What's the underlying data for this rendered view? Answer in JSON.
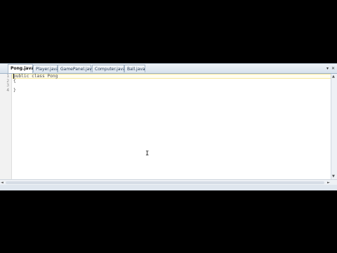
{
  "tabs": [
    {
      "label": "Pong.java",
      "active": true
    },
    {
      "label": "Player.java",
      "active": false
    },
    {
      "label": "GamePanel.java",
      "active": false
    },
    {
      "label": "Computer.java",
      "active": false
    },
    {
      "label": "Ball.java",
      "active": false
    }
  ],
  "tabbar_controls": {
    "dropdown": "▾",
    "close": "✕"
  },
  "editor": {
    "lines": [
      {
        "number": "1",
        "text": "public class Pong"
      },
      {
        "number": "2",
        "text": "{"
      },
      {
        "number": "3",
        "text": ""
      },
      {
        "number": "4",
        "text": "}"
      }
    ]
  },
  "scroll": {
    "up": "▲",
    "down": "▼",
    "left": "◄",
    "right": "►"
  },
  "cursor_glyph": "I",
  "colors": {
    "current_line_border": "#f6e79a",
    "tab_active_bg": "#ffffff",
    "frame_bg": "#dfe6ee"
  }
}
